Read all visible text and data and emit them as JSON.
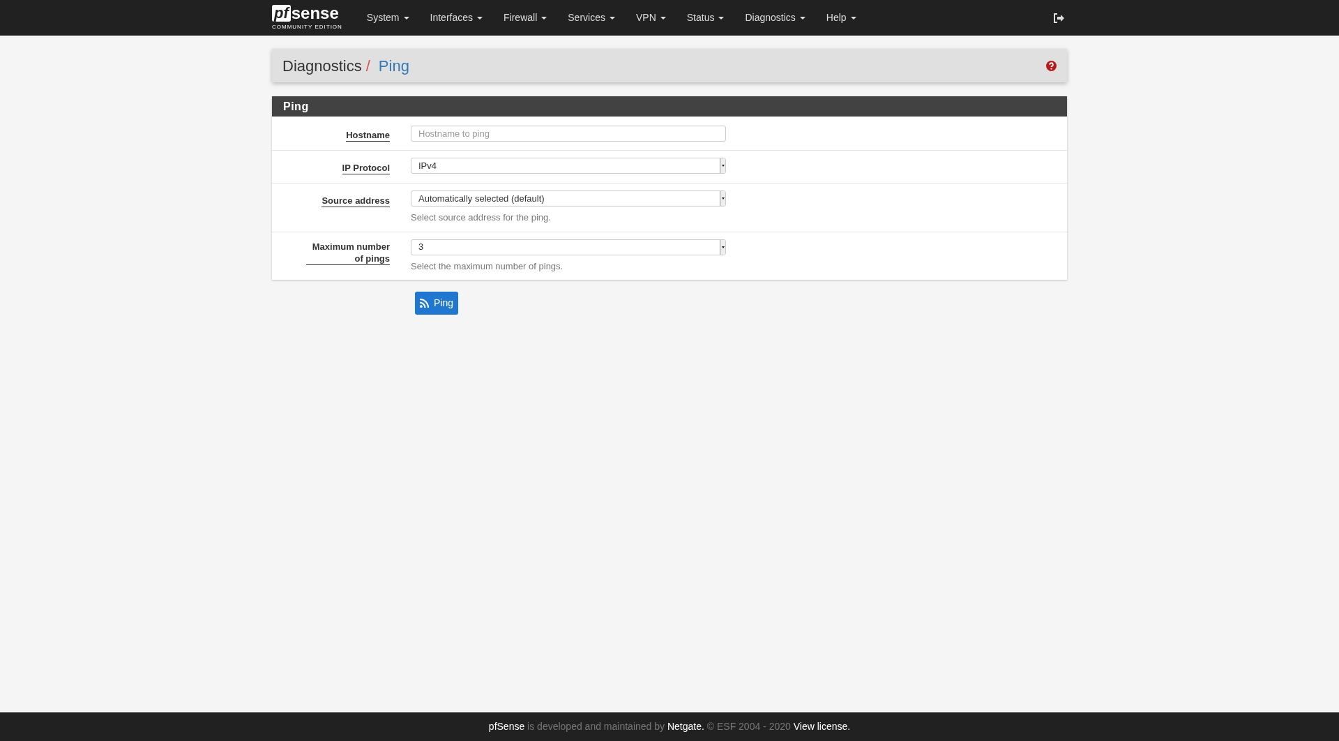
{
  "navbar": {
    "logo": {
      "mark": "pf",
      "word": "sense",
      "edition": "COMMUNITY EDITION"
    },
    "menus": [
      {
        "label": "System"
      },
      {
        "label": "Interfaces"
      },
      {
        "label": "Firewall"
      },
      {
        "label": "Services"
      },
      {
        "label": "VPN"
      },
      {
        "label": "Status"
      },
      {
        "label": "Diagnostics"
      },
      {
        "label": "Help"
      }
    ]
  },
  "breadcrumb": {
    "parent": "Diagnostics",
    "separator": "/",
    "current": "Ping"
  },
  "panel": {
    "title": "Ping",
    "fields": [
      {
        "kind": "text",
        "label": "Hostname",
        "placeholder": "Hostname to ping"
      },
      {
        "kind": "select",
        "label": "IP Protocol",
        "value": "IPv4"
      },
      {
        "kind": "select",
        "label": "Source address",
        "value": "Automatically selected (default)",
        "help": "Select source address for the ping."
      },
      {
        "kind": "select",
        "label": "Maximum number of pings",
        "value": "3",
        "help": "Select the maximum number of pings."
      }
    ]
  },
  "submit_button": {
    "label": "Ping"
  },
  "footer": [
    {
      "kind": "link",
      "text": "pfSense"
    },
    {
      "kind": "text",
      "text": "is developed and maintained by"
    },
    {
      "kind": "link",
      "text": "Netgate."
    },
    {
      "kind": "text",
      "text": "© ESF 2004 - 2020"
    },
    {
      "kind": "link",
      "text": "View license."
    }
  ]
}
